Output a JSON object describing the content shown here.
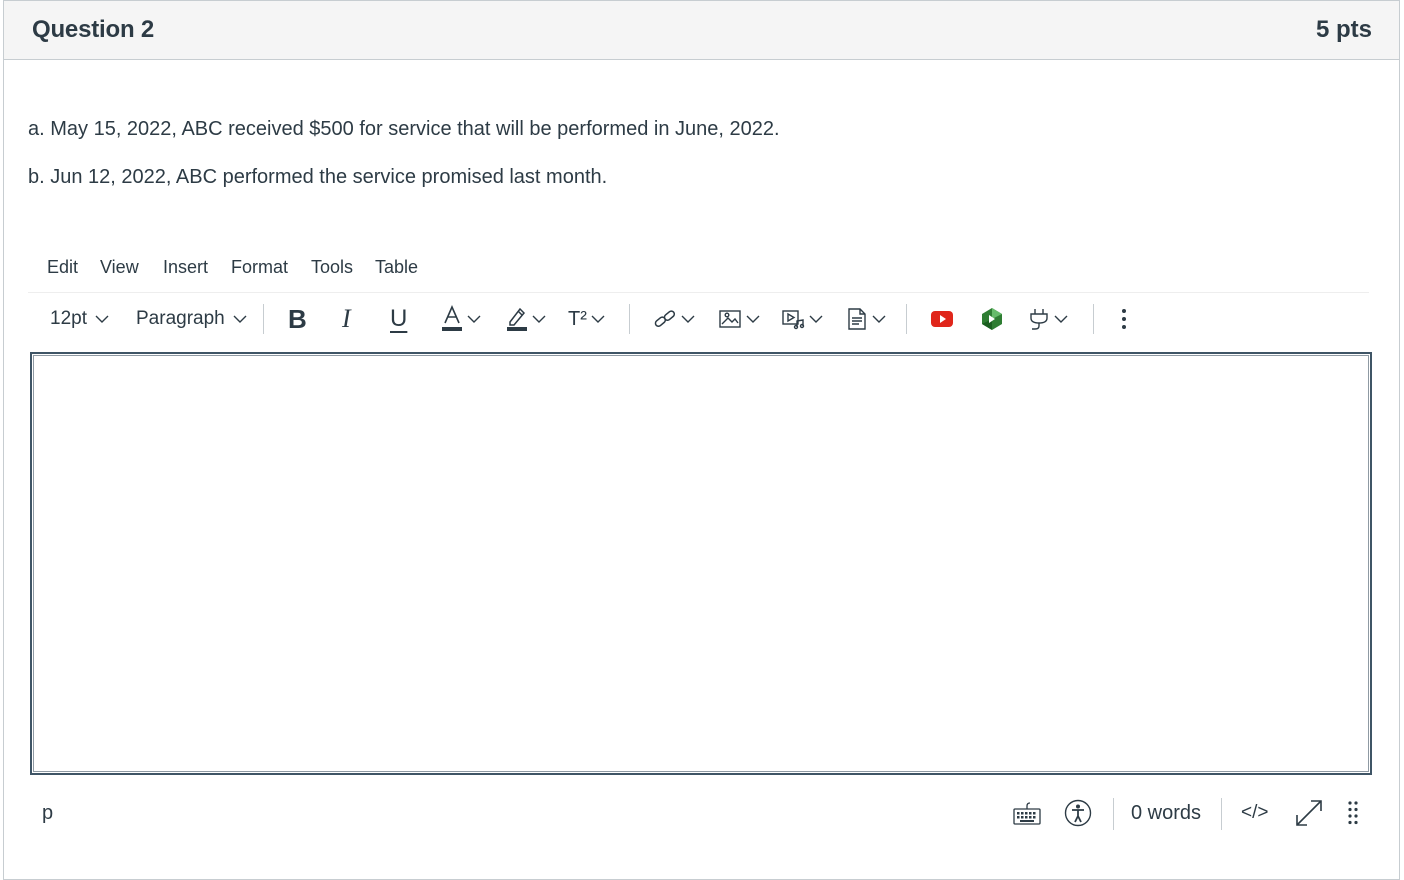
{
  "question": {
    "title": "Question 2",
    "points": "5 pts",
    "lines": [
      "a. May 15, 2022, ABC received $500 for service that will be performed in June, 2022.",
      "b. Jun 12, 2022, ABC performed the service promised last month."
    ]
  },
  "menubar": {
    "items": [
      "Edit",
      "View",
      "Insert",
      "Format",
      "Tools",
      "Table"
    ]
  },
  "toolbar": {
    "font_size": "12pt",
    "block_format": "Paragraph",
    "bold": "B",
    "italic": "I",
    "underline": "U",
    "superscript": "T²"
  },
  "status_bar": {
    "element_path": "p",
    "word_count": "0 words",
    "html_editor": "</>"
  },
  "colors": {
    "text": "#2d3b45",
    "header_bg": "#f5f5f5",
    "border": "#c7cdd1",
    "youtube_red": "#e0261b",
    "app_green": "#2e7d32"
  },
  "icons": {
    "text_color": "text-color-icon",
    "highlight": "highlight-icon",
    "link": "link-icon",
    "image": "image-icon",
    "media": "media-icon",
    "document": "document-icon",
    "youtube": "youtube-icon",
    "apps": "apps-icon",
    "plugin": "plug-icon",
    "more": "more-vertical-icon",
    "keyboard": "keyboard-icon",
    "accessibility": "accessibility-icon",
    "fullscreen": "fullscreen-icon",
    "resize": "resize-handle-icon"
  }
}
